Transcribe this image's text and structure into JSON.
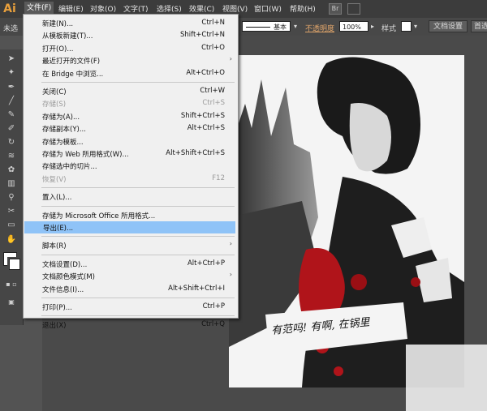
{
  "app": {
    "logo": "Ai"
  },
  "menubar": {
    "items": [
      "文件(F)",
      "编辑(E)",
      "对象(O)",
      "文字(T)",
      "选择(S)",
      "效果(C)",
      "视图(V)",
      "窗口(W)",
      "帮助(H)"
    ],
    "active_index": 0
  },
  "controlbar": {
    "left_text": "未选",
    "stroke_style": "基本",
    "opacity_label": "不透明度",
    "opacity_value": "100%",
    "style_label": "样式",
    "doc_setup": "文档设置",
    "prefs": "首选项"
  },
  "file_menu": [
    {
      "label": "新建(N)...",
      "shortcut": "Ctrl+N"
    },
    {
      "label": "从模板新建(T)...",
      "shortcut": "Shift+Ctrl+N"
    },
    {
      "label": "打开(O)...",
      "shortcut": "Ctrl+O"
    },
    {
      "label": "最近打开的文件(F)",
      "shortcut": "",
      "submenu": true
    },
    {
      "label": "在 Bridge 中浏览...",
      "shortcut": "Alt+Ctrl+O"
    },
    {
      "sep": true
    },
    {
      "label": "关闭(C)",
      "shortcut": "Ctrl+W"
    },
    {
      "label": "存储(S)",
      "shortcut": "Ctrl+S",
      "disabled": true
    },
    {
      "label": "存储为(A)...",
      "shortcut": "Shift+Ctrl+S"
    },
    {
      "label": "存储副本(Y)...",
      "shortcut": "Alt+Ctrl+S"
    },
    {
      "label": "存储为模板...",
      "shortcut": ""
    },
    {
      "label": "存储为 Web 所用格式(W)...",
      "shortcut": "Alt+Shift+Ctrl+S"
    },
    {
      "label": "存储选中的切片...",
      "shortcut": ""
    },
    {
      "label": "恢复(V)",
      "shortcut": "F12",
      "disabled": true
    },
    {
      "sep": true
    },
    {
      "label": "置入(L)...",
      "shortcut": ""
    },
    {
      "sep": true
    },
    {
      "label": "存储为 Microsoft Office 所用格式...",
      "shortcut": ""
    },
    {
      "label": "导出(E)...",
      "shortcut": "",
      "highlighted": true
    },
    {
      "sep": true
    },
    {
      "label": "脚本(R)",
      "shortcut": "",
      "submenu": true
    },
    {
      "sep": true
    },
    {
      "label": "文档设置(D)...",
      "shortcut": "Alt+Ctrl+P"
    },
    {
      "label": "文档颜色模式(M)",
      "shortcut": "",
      "submenu": true
    },
    {
      "label": "文件信息(I)...",
      "shortcut": "Alt+Shift+Ctrl+I"
    },
    {
      "sep": true
    },
    {
      "label": "打印(P)...",
      "shortcut": "Ctrl+P"
    },
    {
      "sep": true
    },
    {
      "label": "退出(X)",
      "shortcut": "Ctrl+Q"
    }
  ],
  "artwork": {
    "handwriting": "有范吗! 有啊, 在锅里",
    "colors": {
      "blood": "#b0141a",
      "ink": "#1a1a1a",
      "paper": "#f4f4f4"
    }
  },
  "colors": {
    "menubar_bg": "#3c3c3c",
    "menu_bg": "#f0f0f0",
    "highlight": "#8fc3f7",
    "logo": "#e9a03c"
  }
}
